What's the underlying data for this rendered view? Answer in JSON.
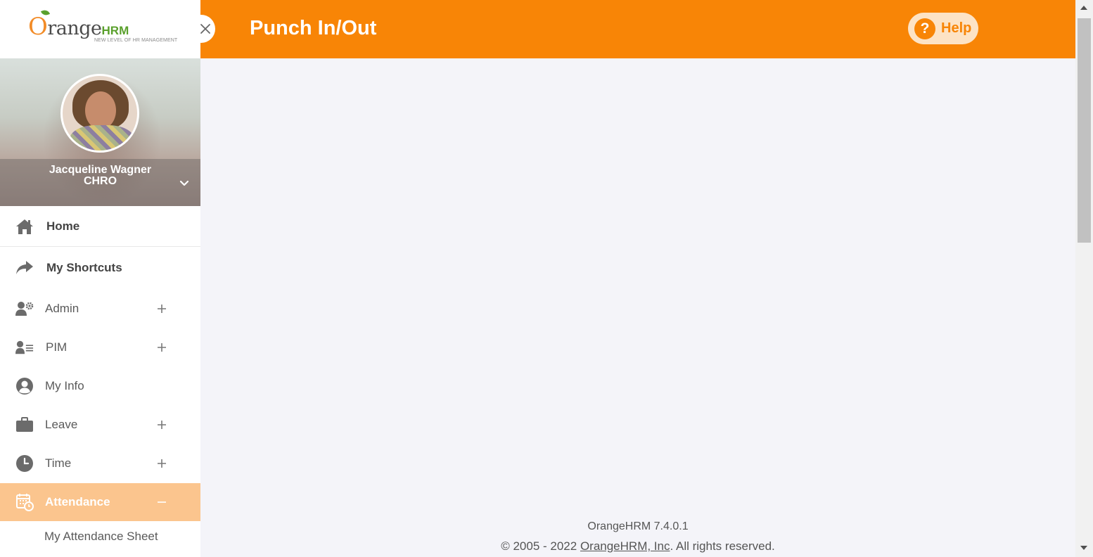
{
  "logo": {
    "prefix": "O",
    "main": "range",
    "suffix": "HRM",
    "tagline": "NEW LEVEL OF HR MANAGEMENT"
  },
  "user": {
    "name": "Jacqueline Wagner",
    "role": "CHRO"
  },
  "header": {
    "title": "Punch In/Out",
    "help_label": "Help",
    "help_symbol": "?"
  },
  "menu": {
    "items": [
      {
        "label": "Home",
        "icon": "home-icon"
      },
      {
        "label": "My Shortcuts",
        "icon": "share-arrow-icon"
      },
      {
        "label": "Admin",
        "icon": "user-gear-icon",
        "expand": "+"
      },
      {
        "label": "PIM",
        "icon": "user-list-icon",
        "expand": "+"
      },
      {
        "label": "My Info",
        "icon": "user-circle-icon"
      },
      {
        "label": "Leave",
        "icon": "briefcase-icon",
        "expand": "+"
      },
      {
        "label": "Time",
        "icon": "clock-icon",
        "expand": "+"
      },
      {
        "label": "Attendance",
        "icon": "calendar-clock-icon",
        "expand": "−"
      }
    ],
    "sub_item": "My Attendance Sheet"
  },
  "footer": {
    "version": "OrangeHRM 7.4.0.1",
    "copy_prefix": "© 2005 - 2022 ",
    "copy_link": "OrangeHRM, Inc",
    "copy_suffix": ". All rights reserved."
  },
  "colors": {
    "brand_orange": "#f88506",
    "active_menu_bg": "#fbc58e",
    "help_bg": "#fde3c5",
    "content_bg": "#f4f4f9"
  }
}
